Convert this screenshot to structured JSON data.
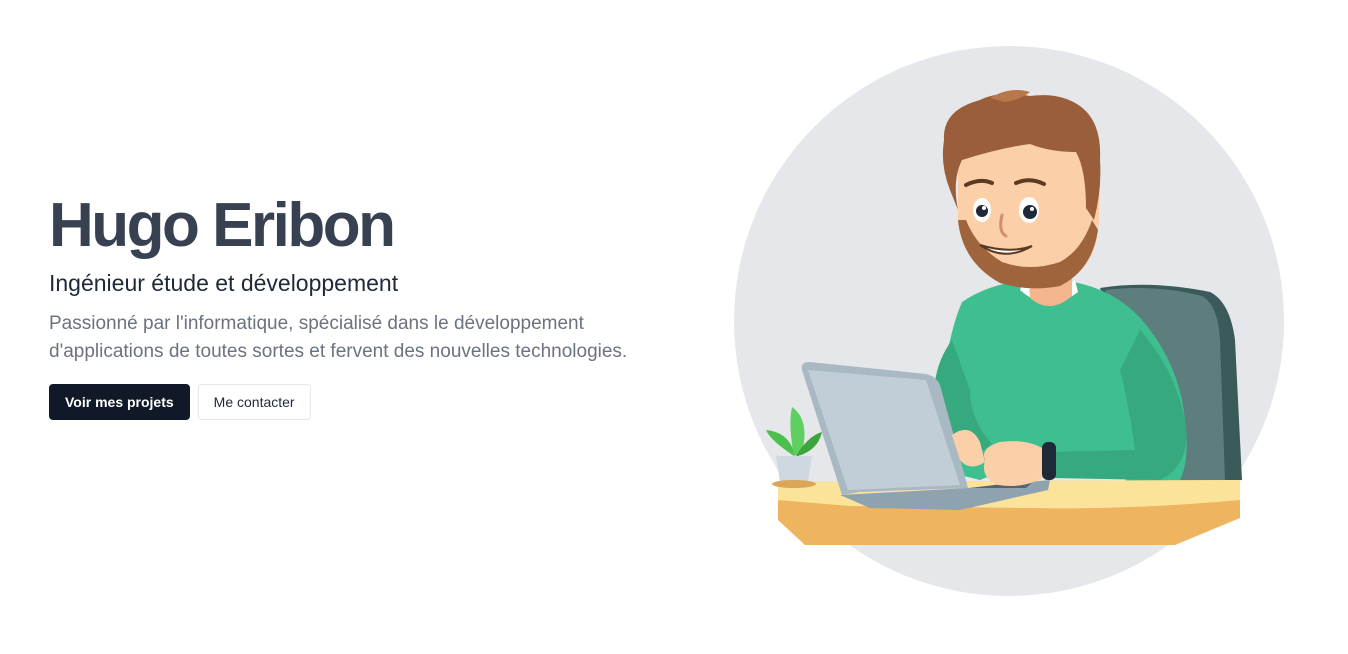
{
  "hero": {
    "name": "Hugo Eribon",
    "role": "Ingénieur étude et développement",
    "description": "Passionné par l'informatique, spécialisé dans le développement d'applications de toutes sortes et fervent des nouvelles technologies.",
    "primary_button": "Voir mes projets",
    "secondary_button": "Me contacter"
  },
  "illustration": {
    "subject": "developer-at-laptop-illustration",
    "colors": {
      "circle": "#e5e7eb",
      "shirt": "#3fbf8f",
      "hair": "#9a5f3a",
      "desk_top": "#fbe49a",
      "desk_edge": "#eeb45f",
      "laptop": "#a9b9c4",
      "chair": "#3b5a5a",
      "plant": "#4cbf4c"
    }
  },
  "theme": {
    "text_dark": "#374151",
    "text_muted": "#6b7280",
    "primary": "#111827"
  }
}
